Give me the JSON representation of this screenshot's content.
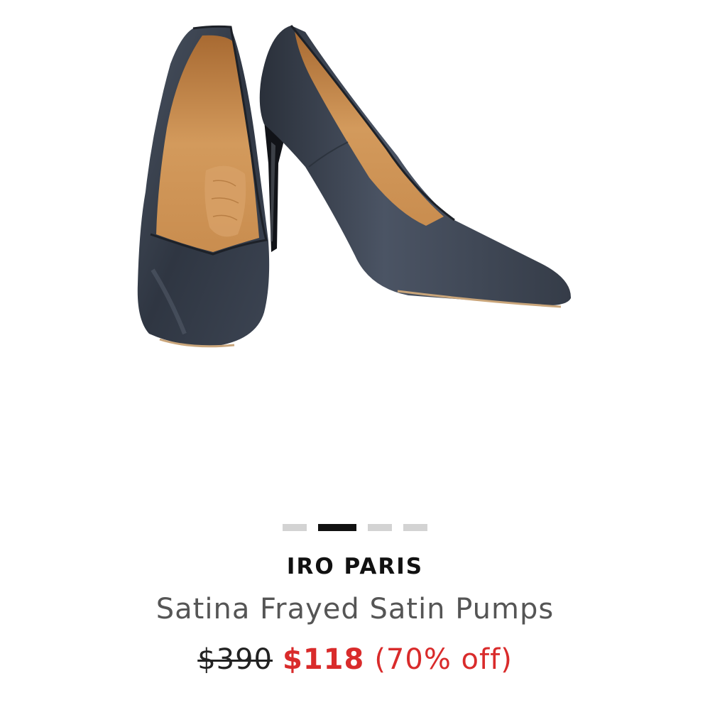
{
  "gallery": {
    "image_alt": "Satina Frayed Satin Pumps",
    "slides": 4,
    "active_slide": 2
  },
  "product": {
    "brand": "IRO PARIS",
    "name": "Satina Frayed Satin Pumps",
    "price_original": "$390",
    "price_sale": "$118",
    "discount": "(70% off)"
  },
  "colors": {
    "sale": "#d92b2b",
    "satin": "#3d4654",
    "lining": "#c98d4f",
    "dot_active": "#111111",
    "dot_inactive": "#d3d3d3"
  }
}
